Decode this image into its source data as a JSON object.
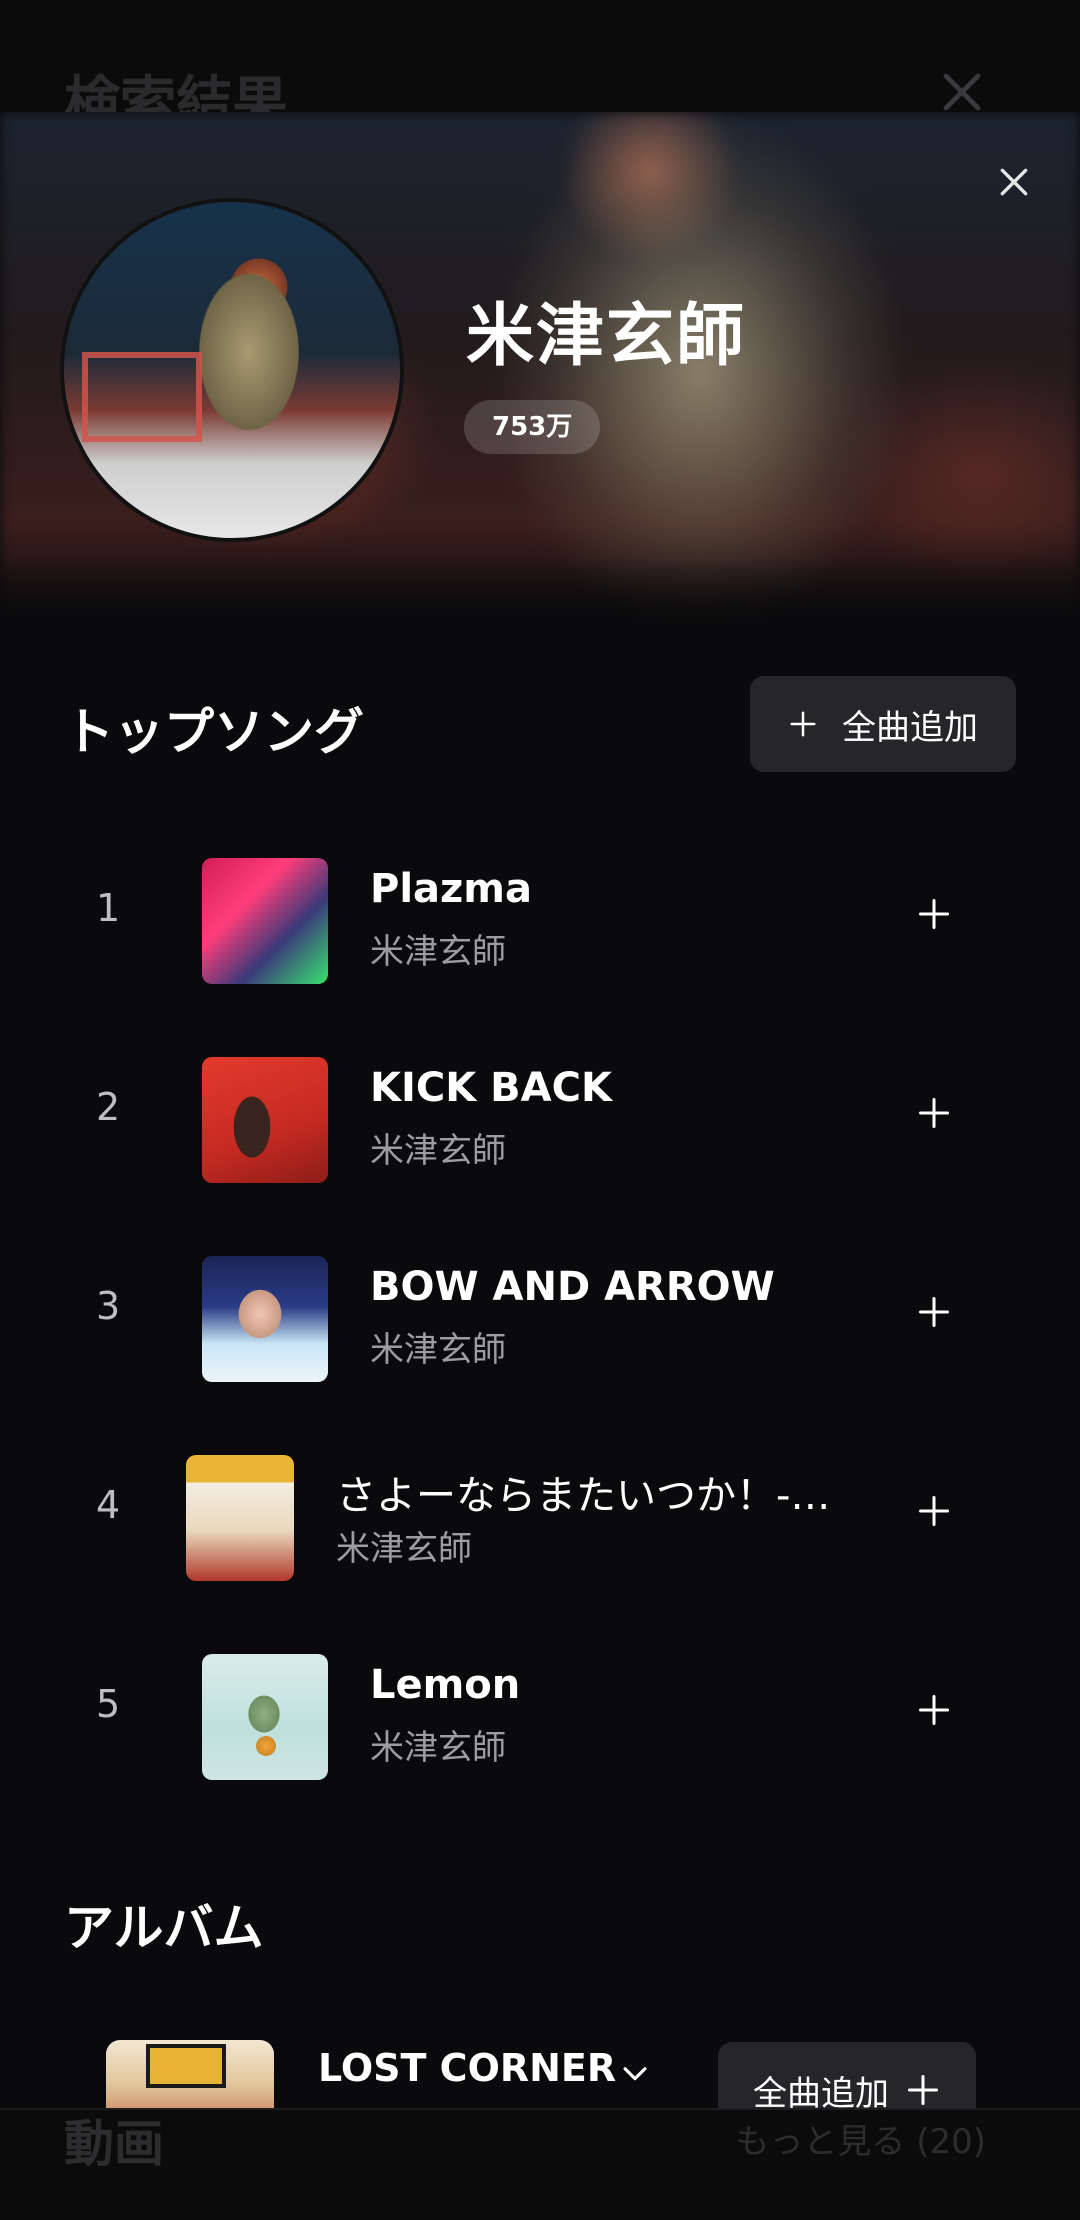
{
  "background": {
    "title": "検索結果",
    "bottom_section": "動画",
    "more_link": "もっと見る (20)"
  },
  "artist": {
    "name": "米津玄師",
    "followers": "753万"
  },
  "top_songs": {
    "title": "トップソング",
    "add_all_label": "全曲追加",
    "items": [
      {
        "rank": "1",
        "title": "Plazma",
        "artist": "米津玄師"
      },
      {
        "rank": "2",
        "title": "KICK BACK",
        "artist": "米津玄師"
      },
      {
        "rank": "3",
        "title": "BOW AND ARROW",
        "artist": "米津玄師"
      },
      {
        "rank": "4",
        "title": "さよーならまたいつか！-…",
        "artist": "米津玄師"
      },
      {
        "rank": "5",
        "title": "Lemon",
        "artist": "米津玄師"
      }
    ]
  },
  "albums": {
    "title": "アルバム",
    "items": [
      {
        "title": "LOST CORNER",
        "add_label": "全曲追加"
      }
    ]
  }
}
